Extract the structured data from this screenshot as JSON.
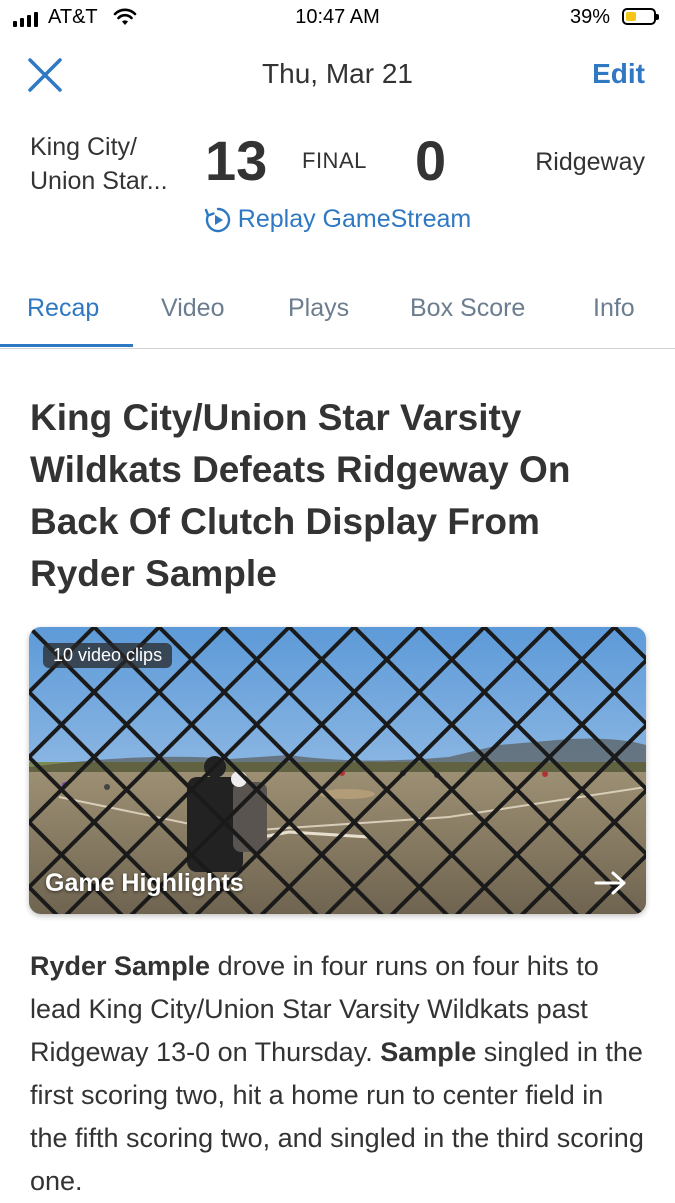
{
  "status_bar": {
    "carrier": "AT&T",
    "time": "10:47 AM",
    "battery_percent": "39%",
    "battery_level": 0.39,
    "battery_color": "#f5c518"
  },
  "nav": {
    "close_icon": "close-icon",
    "date": "Thu, Mar 21",
    "edit_label": "Edit"
  },
  "scoreboard": {
    "home_team_line1": "King City/",
    "home_team_line2": "Union Star...",
    "home_score": "13",
    "status": "FINAL",
    "away_score": "0",
    "away_team": "Ridgeway"
  },
  "replay": {
    "icon": "replay-icon",
    "label": "Replay GameStream"
  },
  "tabs": [
    {
      "label": "Recap",
      "active": true
    },
    {
      "label": "Video",
      "active": false
    },
    {
      "label": "Plays",
      "active": false
    },
    {
      "label": "Box Score",
      "active": false
    },
    {
      "label": "Info",
      "active": false
    }
  ],
  "article": {
    "headline": "King City/Union Star Varsity Wildkats Defeats Ridgeway On Back Of Clutch Display From Ryder Sample",
    "video": {
      "clips_label": "10 video clips",
      "title": "Game Highlights",
      "arrow_icon": "arrow-right-icon"
    },
    "body": {
      "p1_bold": "Ryder Sample",
      "p1_text": " drove in four runs on four hits to lead King City/Union Star Varsity Wildkats past Ridgeway 13-0 on Thursday. ",
      "p2_bold": "Sample",
      "p2_text": " singled in the first scoring two, hit a home run to center field in the fifth scoring two, and singled in the third scoring one."
    }
  },
  "colors": {
    "accent": "#2f78c4",
    "text": "#333333",
    "tab_inactive": "#6b7d8f"
  }
}
